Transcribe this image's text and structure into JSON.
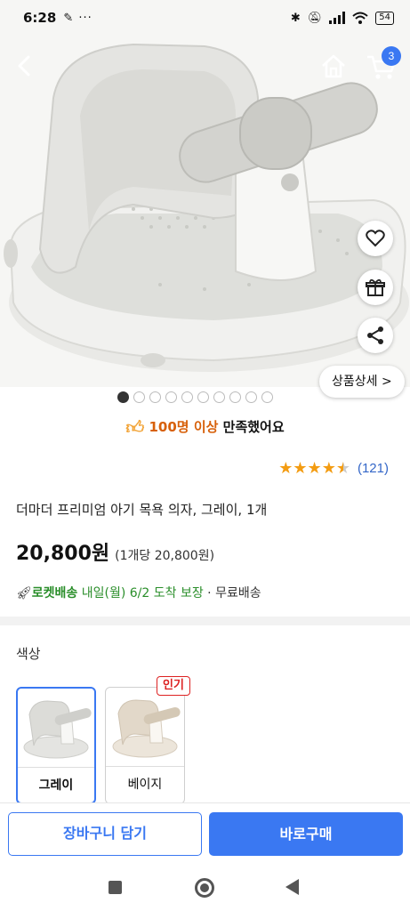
{
  "status_bar": {
    "time": "6:28",
    "left_icons": "✎ ···",
    "battery": "54"
  },
  "nav": {
    "cart_count": "3"
  },
  "detail_button": "상품상세 >",
  "pagination": {
    "total": 10,
    "active": 0
  },
  "satisfaction": {
    "highlight": "100명 이상",
    "rest": " 만족했어요"
  },
  "rating": {
    "stars": 4.5,
    "count": "(121)"
  },
  "product": {
    "title": "더마더 프리미엄 아기 목욕 의자, 그레이, 1개",
    "price": "20,800원",
    "unit_price": "(1개당 20,800원)"
  },
  "delivery": {
    "rocket": "로켓배송",
    "arrival": " 내일(월) 6/2 도착 보장",
    "shipping": " · 무료배송"
  },
  "options": {
    "label": "색상",
    "popular_badge": "인기",
    "items": [
      {
        "name": "그레이",
        "selected": true,
        "color": "#dcdcd8"
      },
      {
        "name": "베이지",
        "selected": false,
        "color": "#e6ddd0"
      }
    ]
  },
  "actions": {
    "add_to_cart": "장바구니 담기",
    "buy_now": "바로구매"
  },
  "colors": {
    "accent": "#3a78f2",
    "rocket_green": "#2a8e2a",
    "satisfaction_orange": "#d7600a",
    "star": "#f39c12"
  }
}
